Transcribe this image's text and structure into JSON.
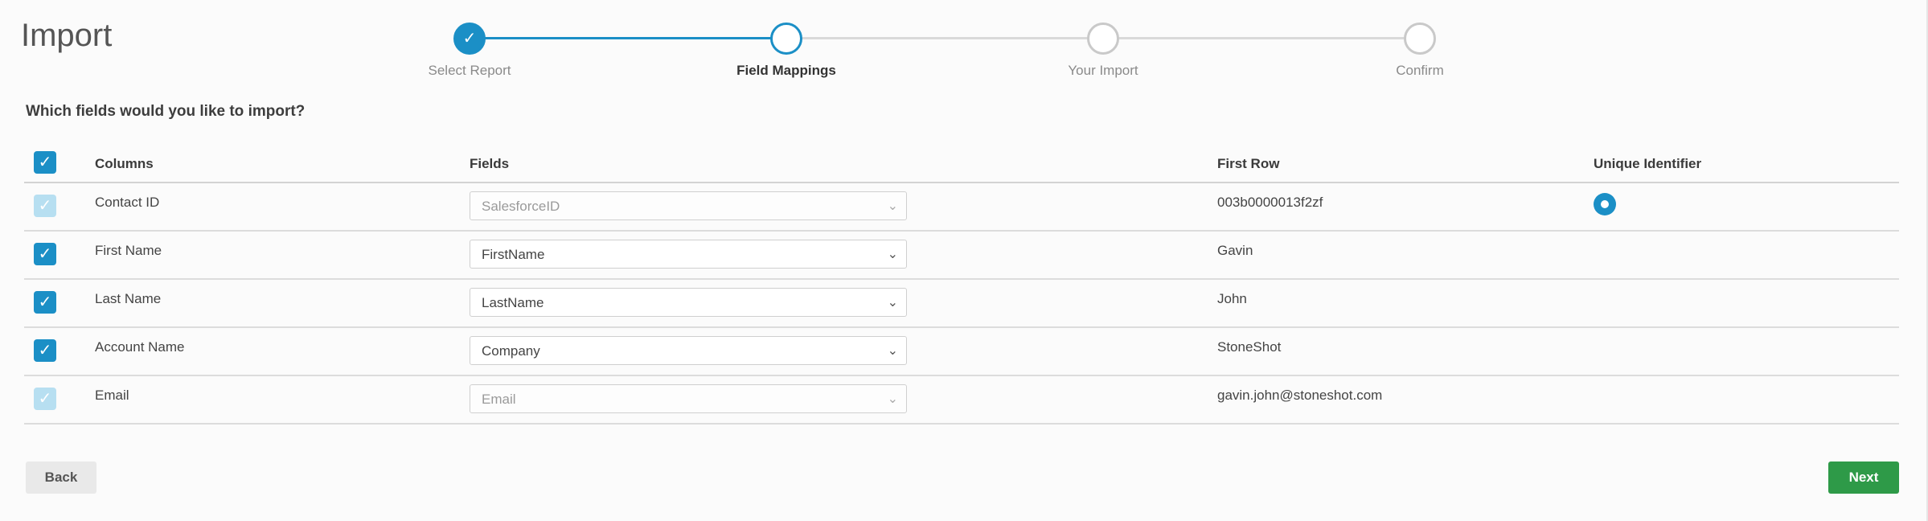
{
  "title": "Import",
  "steps": [
    {
      "label": "Select Report",
      "state": "done"
    },
    {
      "label": "Field Mappings",
      "state": "active"
    },
    {
      "label": "Your Import",
      "state": "pending"
    },
    {
      "label": "Confirm",
      "state": "pending"
    }
  ],
  "question": "Which fields would you like to import?",
  "headers": {
    "columns": "Columns",
    "fields": "Fields",
    "first_row": "First Row",
    "unique": "Unique Identifier"
  },
  "rows": [
    {
      "column": "Contact ID",
      "field": "SalesforceID",
      "first_row": "003b0000013f2zf",
      "checked": true,
      "disabled": true,
      "unique": true
    },
    {
      "column": "First Name",
      "field": "FirstName",
      "first_row": "Gavin",
      "checked": true,
      "disabled": false,
      "unique": false
    },
    {
      "column": "Last Name",
      "field": "LastName",
      "first_row": "John",
      "checked": true,
      "disabled": false,
      "unique": false
    },
    {
      "column": "Account Name",
      "field": "Company",
      "first_row": "StoneShot",
      "checked": true,
      "disabled": false,
      "unique": false
    },
    {
      "column": "Email",
      "field": "Email",
      "first_row": "gavin.john@stoneshot.com",
      "checked": true,
      "disabled": true,
      "unique": false
    }
  ],
  "buttons": {
    "back": "Back",
    "next": "Next"
  },
  "icons": {
    "check": "check-icon",
    "chevron": "chevron-down-icon",
    "radio": "radio-selected-icon"
  },
  "colors": {
    "accent": "#1b8fc6",
    "next": "#2e9a48"
  }
}
